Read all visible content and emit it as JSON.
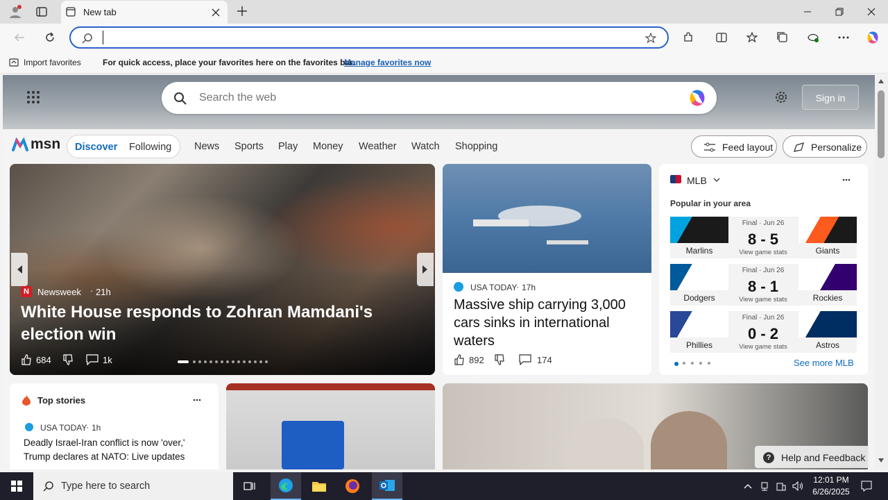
{
  "browser": {
    "tab_title": "New tab",
    "address_value": "",
    "favbar": {
      "import": "Import favorites",
      "message": "For quick access, place your favorites here on the favorites bar.",
      "link": "Manage favorites now"
    }
  },
  "msn": {
    "search_placeholder": "Search the web",
    "sign_in": "Sign in",
    "logo": "msn",
    "nav_tabs": [
      "Discover",
      "Following"
    ],
    "nav_links": [
      "News",
      "Sports",
      "Play",
      "Money",
      "Weather",
      "Watch",
      "Shopping"
    ],
    "feed_layout": "Feed layout",
    "personalize": "Personalize"
  },
  "hero": {
    "source": "Newsweek",
    "age": "21h",
    "title": "White House responds to Zohran Mamdani's election win",
    "likes": "684",
    "comments": "1k"
  },
  "story2": {
    "source": "USA TODAY",
    "age": "17h",
    "title": "Massive ship carrying 3,000 cars sinks in international waters",
    "likes": "892",
    "comments": "174"
  },
  "mlb": {
    "title": "MLB",
    "subtitle": "Popular in your area",
    "see_more": "See more MLB",
    "games": [
      {
        "status": "Final · Jun 26",
        "score": "8 - 5",
        "home": "Marlins",
        "away": "Giants",
        "link": "View game stats"
      },
      {
        "status": "Final · Jun 26",
        "score": "8 - 1",
        "home": "Dodgers",
        "away": "Rockies",
        "link": "View game stats"
      },
      {
        "status": "Final · Jun 26",
        "score": "0 - 2",
        "home": "Phillies",
        "away": "Astros",
        "link": "View game stats"
      }
    ]
  },
  "top_stories": {
    "title": "Top stories",
    "source": "USA TODAY",
    "age": "1h",
    "headline": "Deadly Israel-Iran conflict is now 'over,' Trump declares at NATO: Live updates"
  },
  "help": "Help and Feedback",
  "taskbar": {
    "search_placeholder": "Type here to search",
    "time": "12:01 PM",
    "date": "6/26/2025"
  },
  "colors": {
    "accent": "#2a62c9",
    "taskbar": "#1f1f2b",
    "msn_blue": "#0f6cbd"
  }
}
